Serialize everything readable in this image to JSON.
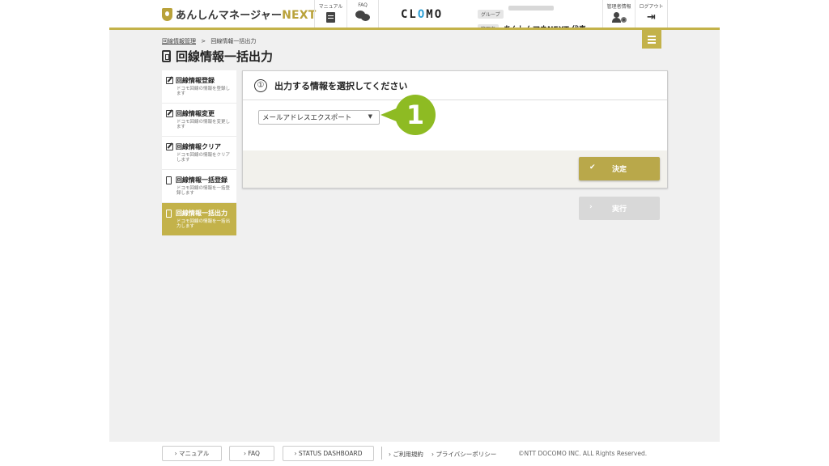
{
  "header": {
    "logo_text": "あんしんマネージャー",
    "logo_next": "NEXT",
    "manual_label": "マニュアル",
    "faq_label": "FAQ",
    "brand": "CLOMO",
    "group_tag": "グループ",
    "admin_tag": "管理者",
    "admin_name": "あんしんマネNEXT 代表…",
    "admin_info_label": "管理者情報",
    "logout_label": "ログアウト"
  },
  "breadcrumb": {
    "parent": "回線情報管理",
    "separator": ">",
    "current": "回線情報一括出力"
  },
  "page_title": "回線情報一括出力",
  "sidebar": {
    "items": [
      {
        "title": "回線情報登録",
        "desc": "ドコモ回線の情報を登録します",
        "icon": "edit-icon",
        "active": false
      },
      {
        "title": "回線情報変更",
        "desc": "ドコモ回線の情報を変更します",
        "icon": "edit-icon",
        "active": false
      },
      {
        "title": "回線情報クリア",
        "desc": "ドコモ回線の情報をクリアします",
        "icon": "edit-icon",
        "active": false
      },
      {
        "title": "回線情報一括登録",
        "desc": "ドコモ回線の情報を一括登録します",
        "icon": "phone-icon",
        "active": false
      },
      {
        "title": "回線情報一括出力",
        "desc": "ドコモ回線の情報を一括出力します",
        "icon": "phone-icon",
        "active": true
      }
    ]
  },
  "panel": {
    "step_number": "①",
    "heading": "出力する情報を選択してください",
    "select_value": "メールアドレスエクスポート",
    "confirm_label": "決定",
    "execute_label": "実行"
  },
  "callout": {
    "number": "1"
  },
  "footer": {
    "manual": "マニュアル",
    "faq": "FAQ",
    "status": "STATUS DASHBOARD",
    "terms": "ご利用規約",
    "privacy": "プライバシーポリシー",
    "copyright": "©NTT DOCOMO INC. ALL Rights Reserved."
  },
  "colors": {
    "accent": "#c3b24a",
    "callout": "#8ebb23",
    "disabled": "#d8d8d8"
  }
}
